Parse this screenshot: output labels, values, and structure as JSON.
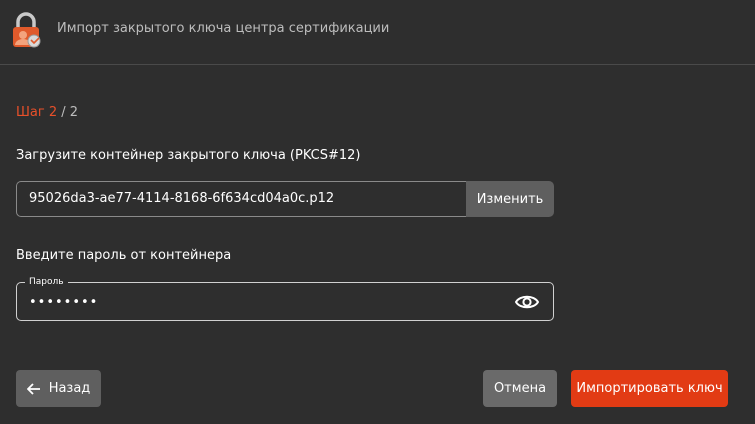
{
  "window": {
    "title": "Импорт закрытого ключа центра сертификации",
    "icon": "lock-certificate-icon"
  },
  "step": {
    "current": "Шаг 2",
    "total": " / 2"
  },
  "file_section": {
    "label": "Загрузите контейнер закрытого ключа (PKCS#12)",
    "value": "95026da3-ae77-4114-8168-6f634cd04a0c.p12",
    "change_label": "Изменить"
  },
  "password_section": {
    "label": "Введите пароль от контейнера",
    "field_label": "Пароль",
    "masked_value": "••••••••",
    "toggle_icon": "eye-icon"
  },
  "footer": {
    "back_label": "Назад",
    "back_icon": "arrow-left-icon",
    "cancel_label": "Отмена",
    "import_label": "Импортировать ключ"
  },
  "colors": {
    "background": "#2e2e2e",
    "accent": "#e23b14",
    "step_accent": "#e8502a",
    "secondary_button": "#5f5f5f"
  }
}
